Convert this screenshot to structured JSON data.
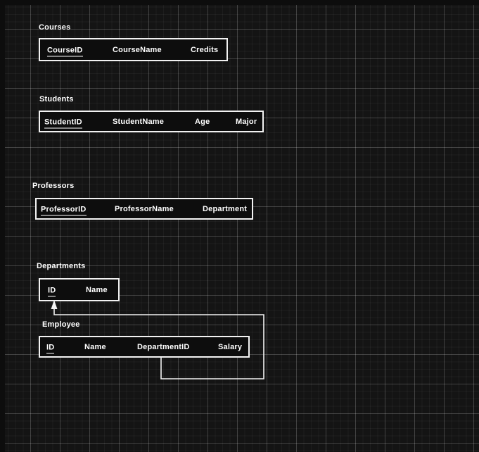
{
  "diagram": {
    "tables": [
      {
        "title": "Courses",
        "columns": [
          {
            "label": "CourseID",
            "primary_key": true
          },
          {
            "label": "CourseName",
            "primary_key": false
          },
          {
            "label": "Credits",
            "primary_key": false
          }
        ]
      },
      {
        "title": "Students",
        "columns": [
          {
            "label": "StudentID",
            "primary_key": true
          },
          {
            "label": "StudentName",
            "primary_key": false
          },
          {
            "label": "Age",
            "primary_key": false
          },
          {
            "label": "Major",
            "primary_key": false
          }
        ]
      },
      {
        "title": "Professors",
        "columns": [
          {
            "label": "ProfessorID",
            "primary_key": true
          },
          {
            "label": "ProfessorName",
            "primary_key": false
          },
          {
            "label": "Department",
            "primary_key": false
          }
        ]
      },
      {
        "title": "Departments",
        "columns": [
          {
            "label": "ID",
            "primary_key": true
          },
          {
            "label": "Name",
            "primary_key": false
          }
        ]
      },
      {
        "title": "Employee",
        "columns": [
          {
            "label": "ID",
            "primary_key": true
          },
          {
            "label": "Name",
            "primary_key": false
          },
          {
            "label": "DepartmentID",
            "primary_key": false
          },
          {
            "label": "Salary",
            "primary_key": false
          }
        ]
      }
    ],
    "relationships": [
      {
        "from_table": "Employee",
        "from_column": "DepartmentID",
        "to_table": "Departments",
        "to_column": "ID",
        "arrow_direction": "up"
      }
    ],
    "colors": {
      "canvas_background": "#141414",
      "grid_minor": "rgba(255,255,255,0.045)",
      "grid_major": "rgba(255,255,255,0.16)",
      "table_fill": "#0d0d0d",
      "table_border": "#f2f2f2",
      "text": "#ffffff",
      "connector": "#f2f2f2"
    }
  }
}
